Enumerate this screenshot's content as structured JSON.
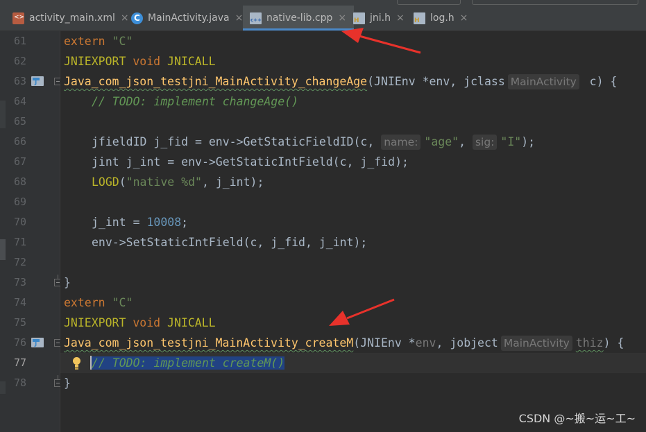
{
  "tabs": [
    {
      "label": "activity_main.xml",
      "icon": "xml-file-icon",
      "close": "×",
      "active": false
    },
    {
      "label": "MainActivity.java",
      "icon": "java-class-icon",
      "close": "×",
      "active": false
    },
    {
      "label": "native-lib.cpp",
      "icon": "cpp-file-icon",
      "close": "×",
      "active": true
    },
    {
      "label": "jni.h",
      "icon": "header-file-icon",
      "close": "×",
      "active": false
    },
    {
      "label": "log.h",
      "icon": "header-file-icon",
      "close": "×",
      "active": false
    }
  ],
  "gutter": {
    "line_numbers": [
      "61",
      "62",
      "63",
      "64",
      "65",
      "66",
      "67",
      "68",
      "69",
      "70",
      "71",
      "72",
      "73",
      "74",
      "75",
      "76",
      "77",
      "78"
    ],
    "current_line": "77"
  },
  "code": {
    "l61": {
      "kw": "extern ",
      "str": "\"C\""
    },
    "l62": {
      "mac": "JNIEXPORT ",
      "kw": "void ",
      "mac2": "JNICALL"
    },
    "l63": {
      "fn": "Java_com_json_testjni_MainActivity_changeAge",
      "p1": "(JNIEnv *env, jclass",
      "hint": "MainActivity",
      "p2": " c) {"
    },
    "l64": {
      "cmt": "// TODO: implement changeAge()"
    },
    "l66": {
      "p1": "jfieldID j_fid = env->GetStaticFieldID(c, ",
      "hint1": "name:",
      "s1": "\"age\"",
      "comma": ", ",
      "hint2": "sig:",
      "s2": "\"I\"",
      "end": ");"
    },
    "l67": {
      "text": "jint j_int = env->GetStaticIntField(c, j_fid);"
    },
    "l68": {
      "mac": "LOGD",
      "p1": "(",
      "str": "\"native %d\"",
      "p2": ", j_int);"
    },
    "l70": {
      "p1": "j_int = ",
      "num": "10008",
      "p2": ";"
    },
    "l71": {
      "text": "env->SetStaticIntField(c, j_fid, j_int);"
    },
    "l73": {
      "text": "}"
    },
    "l74": {
      "kw": "extern ",
      "str": "\"C\""
    },
    "l75": {
      "mac": "JNIEXPORT ",
      "kw": "void ",
      "mac2": "JNICALL"
    },
    "l76": {
      "fn": "Java_com_json_testjni_MainActivity_createM",
      "p1": "(JNIEnv *",
      "env": "env",
      "p2": ", jobject",
      "hint": "MainActivity",
      "thiz": "thiz",
      "p3": ") {"
    },
    "l77": {
      "cmt": "// TODO: implement createM()"
    },
    "l78": {
      "text": "}"
    }
  },
  "watermark": "CSDN @~搬~运~工~",
  "colors": {
    "keyword": "#cc7832",
    "string": "#6a8759",
    "comment": "#629755",
    "macro": "#bbb529",
    "function": "#ffc66d",
    "number": "#6897bb",
    "arrow": "#e8322b",
    "tab_underline": "#4a88c7"
  }
}
